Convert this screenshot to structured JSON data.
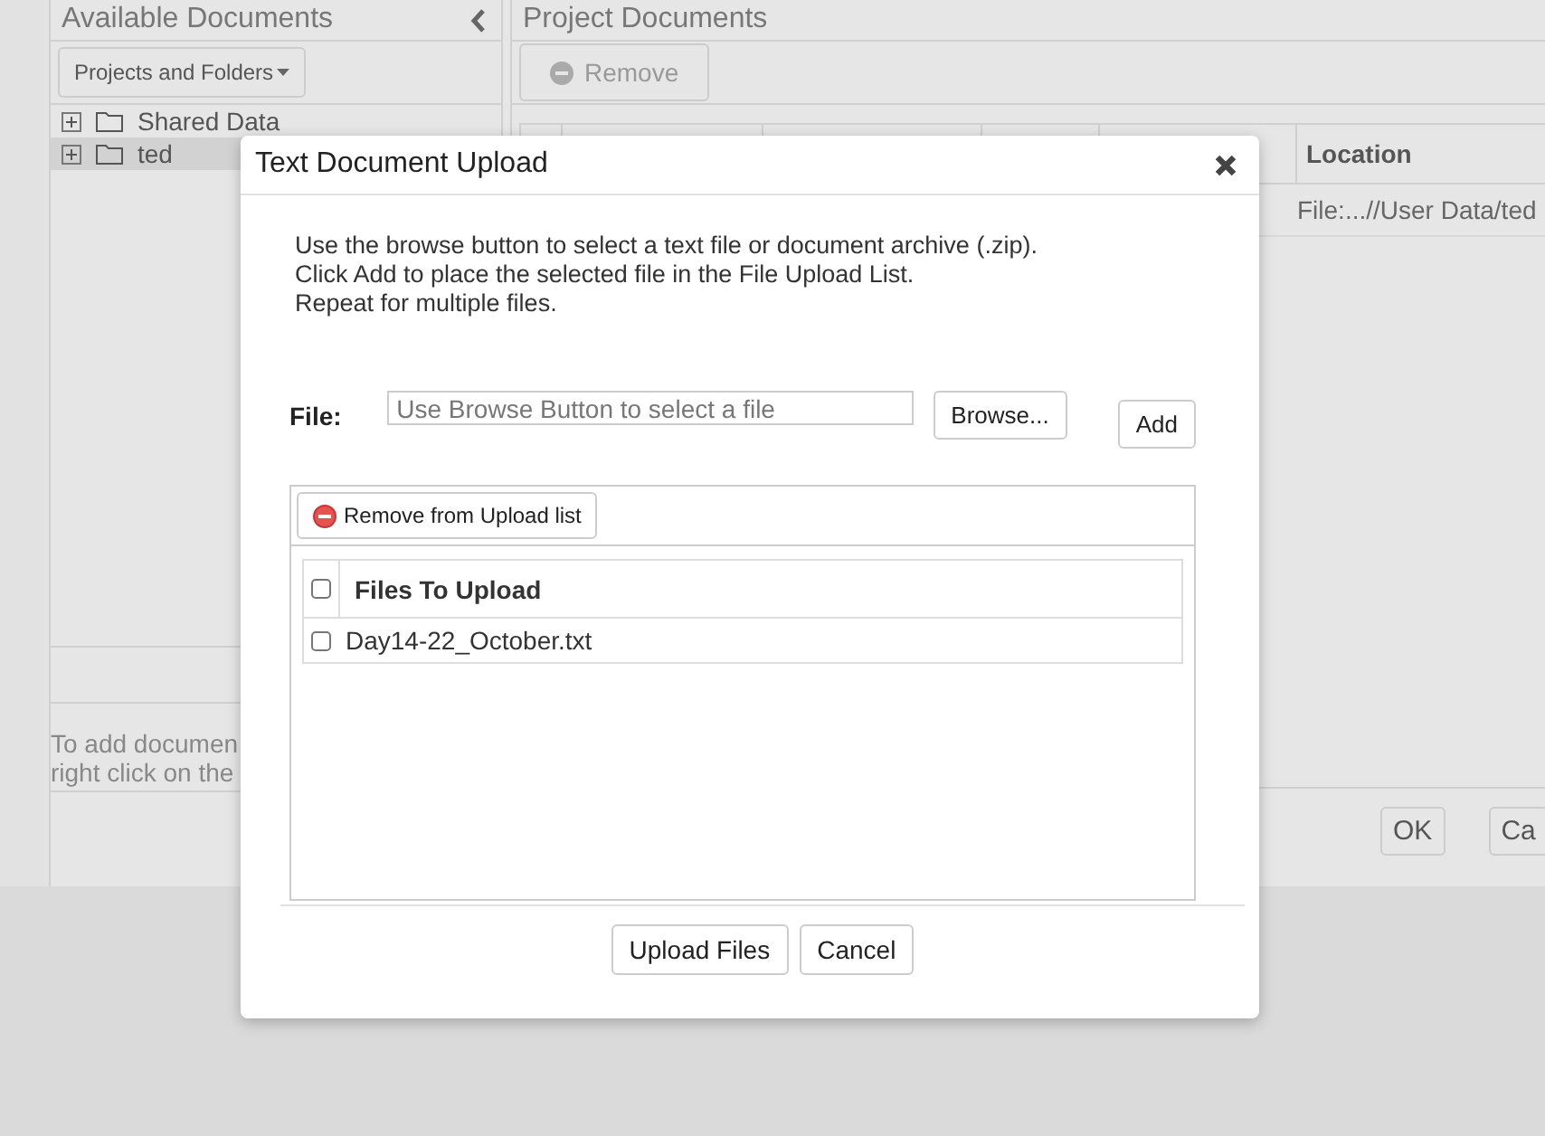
{
  "background": {
    "left_panel": {
      "title": "Available Documents",
      "dropdown": "Projects and Folders",
      "tree": [
        {
          "label": "Shared Data",
          "selected": false
        },
        {
          "label": "ted",
          "selected": true
        }
      ],
      "hint_lines": [
        "To add documen",
        "right click on the"
      ]
    },
    "right_panel": {
      "title": "Project Documents",
      "remove_button": {
        "label": "Remove",
        "disabled": true
      },
      "table": {
        "columns": [
          "Location"
        ],
        "rows": [
          [
            "File:...//User Data/ted"
          ]
        ]
      }
    },
    "buttons": [
      "OK",
      "Ca"
    ]
  },
  "dialog": {
    "title": "Text Document Upload",
    "instructions": [
      "Use the browse button to select a text file or document archive (.zip).",
      "Click Add to place the selected file in the File Upload List.",
      "Repeat for multiple files."
    ],
    "file_label": "File:",
    "file_field": {
      "placeholder": "Use Browse Button to select a file"
    },
    "browse_button": "Browse...",
    "add_button": "Add",
    "remove_button": "Remove from Upload list",
    "list": {
      "header": "Files To Upload",
      "header_checked": false,
      "rows": [
        {
          "name": "Day14-22_October.txt",
          "checked": false
        }
      ]
    },
    "footer_buttons": [
      "Upload Files",
      "Cancel"
    ]
  }
}
